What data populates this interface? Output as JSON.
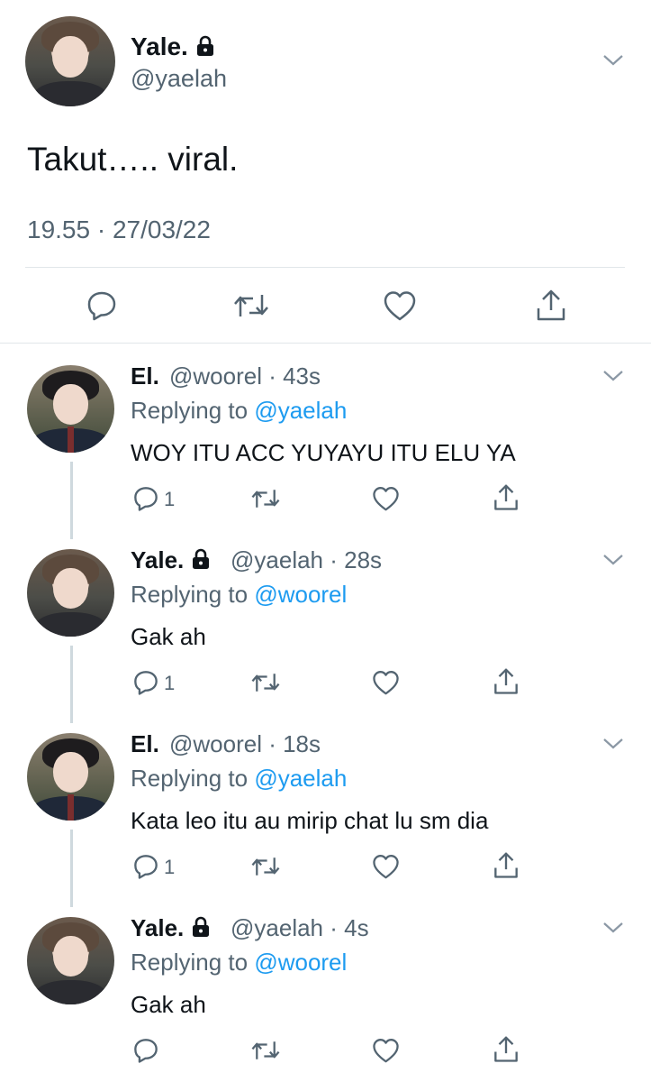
{
  "main_tweet": {
    "name": "Yale.",
    "handle": "@yaelah",
    "text": "Takut….. viral.",
    "timestamp": "19.55 · 27/03/22"
  },
  "replies": [
    {
      "name": "El.",
      "handle": "@woorel",
      "time": "· 43s",
      "replying_prefix": "Replying to",
      "replying_to": "@yaelah",
      "text": "WOY ITU ACC YUYAYU ITU ELU YA",
      "reply_count": "1",
      "locked": false
    },
    {
      "name": "Yale.",
      "handle": "@yaelah",
      "time": "· 28s",
      "replying_prefix": "Replying to",
      "replying_to": "@woorel",
      "text": "Gak ah",
      "reply_count": "1",
      "locked": true
    },
    {
      "name": "El.",
      "handle": "@woorel",
      "time": "· 18s",
      "replying_prefix": "Replying to",
      "replying_to": "@yaelah",
      "text": "Kata leo itu au mirip chat lu sm dia",
      "reply_count": "1",
      "locked": false
    },
    {
      "name": "Yale.",
      "handle": "@yaelah",
      "time": "· 4s",
      "replying_prefix": "Replying to",
      "replying_to": "@woorel",
      "text": "Gak ah",
      "reply_count": "",
      "locked": true
    }
  ],
  "colors": {
    "accent": "#1d9bf0",
    "secondary_text": "#536471",
    "primary_text": "#0f1419",
    "divider": "#e1e6ea"
  },
  "icons": [
    "lock-icon",
    "chevron-down-icon",
    "reply-icon",
    "retweet-icon",
    "like-icon",
    "share-icon"
  ]
}
